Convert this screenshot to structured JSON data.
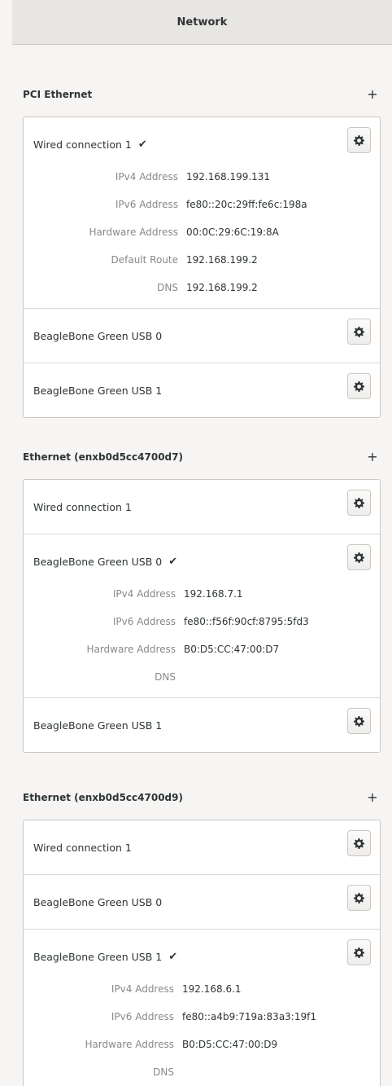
{
  "window": {
    "title": "Network"
  },
  "sections": [
    {
      "title": "PCI Ethernet",
      "add_label": "+",
      "connections": [
        {
          "name": "Wired connection 1",
          "active": true,
          "details": [
            {
              "label": "IPv4 Address",
              "value": "192.168.199.131"
            },
            {
              "label": "IPv6 Address",
              "value": "fe80::20c:29ff:fe6c:198a"
            },
            {
              "label": "Hardware Address",
              "value": "00:0C:29:6C:19:8A"
            },
            {
              "label": "Default Route",
              "value": "192.168.199.2"
            },
            {
              "label": "DNS",
              "value": "192.168.199.2"
            }
          ]
        },
        {
          "name": "BeagleBone Green USB 0",
          "active": false
        },
        {
          "name": "BeagleBone Green USB 1",
          "active": false
        }
      ]
    },
    {
      "title": "Ethernet (enxb0d5cc4700d7)",
      "add_label": "+",
      "connections": [
        {
          "name": "Wired connection 1",
          "active": false
        },
        {
          "name": "BeagleBone Green USB 0",
          "active": true,
          "details": [
            {
              "label": "IPv4 Address",
              "value": "192.168.7.1"
            },
            {
              "label": "IPv6 Address",
              "value": "fe80::f56f:90cf:8795:5fd3"
            },
            {
              "label": "Hardware Address",
              "value": "B0:D5:CC:47:00:D7"
            },
            {
              "label": "DNS",
              "value": ""
            }
          ]
        },
        {
          "name": "BeagleBone Green USB 1",
          "active": false
        }
      ]
    },
    {
      "title": "Ethernet (enxb0d5cc4700d9)",
      "add_label": "+",
      "connections": [
        {
          "name": "Wired connection 1",
          "active": false
        },
        {
          "name": "BeagleBone Green USB 0",
          "active": false
        },
        {
          "name": "BeagleBone Green USB 1",
          "active": true,
          "details": [
            {
              "label": "IPv4 Address",
              "value": "192.168.6.1"
            },
            {
              "label": "IPv6 Address",
              "value": "fe80::a4b9:719a:83a3:19f1"
            },
            {
              "label": "Hardware Address",
              "value": "B0:D5:CC:47:00:D9"
            },
            {
              "label": "DNS",
              "value": ""
            }
          ]
        }
      ]
    }
  ],
  "icons": {
    "active_check": "checkmark-icon",
    "settings": "gear-icon",
    "add": "plus-icon"
  }
}
